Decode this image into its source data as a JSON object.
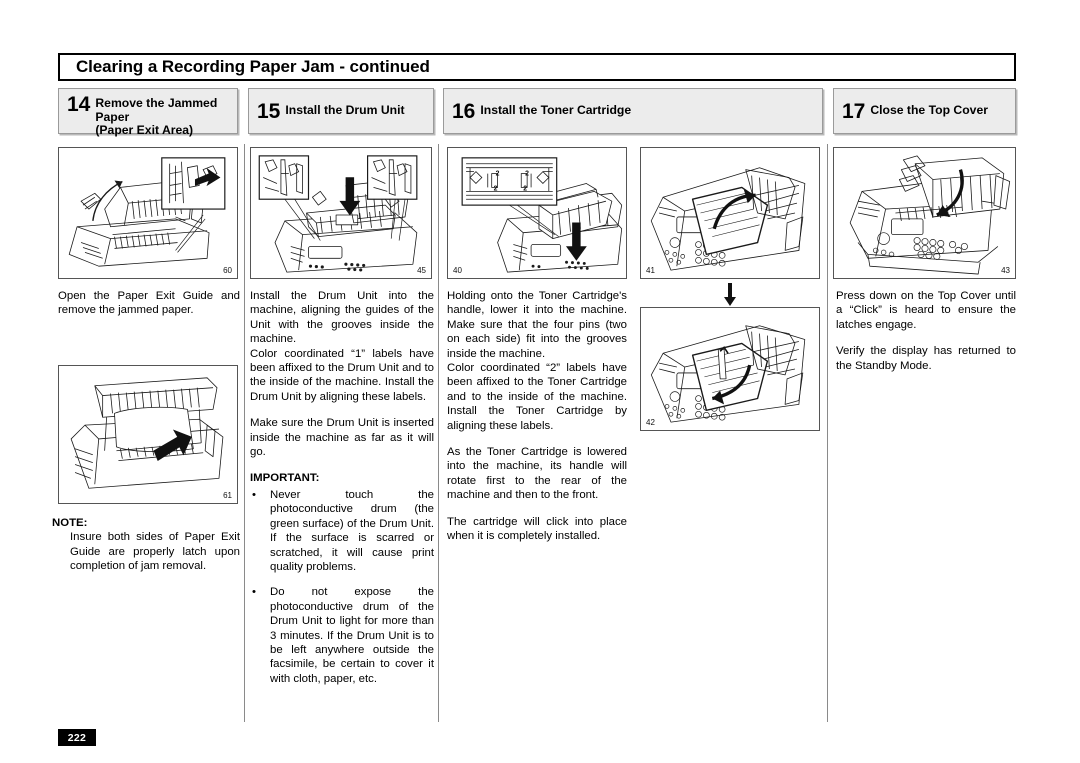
{
  "document": {
    "title": "Clearing a Recording Paper Jam - continued",
    "page_number": "222"
  },
  "steps": [
    {
      "number": "14",
      "label": "Remove the Jammed Paper\n(Paper Exit Area)",
      "figures": [
        {
          "id": "60",
          "caption_number": "60",
          "alt": "fuser-unit-paper-exit-guide-open-diagram"
        },
        {
          "id": "61",
          "caption_number": "61",
          "alt": "removing-jammed-paper-from-exit-area-diagram"
        }
      ],
      "body": [
        "Open the Paper Exit Guide and remove the jammed paper."
      ],
      "note": {
        "label": "NOTE:",
        "text": "Insure both sides of Paper Exit Guide are properly latch upon completion of jam removal."
      }
    },
    {
      "number": "15",
      "label": "Install the Drum Unit",
      "figures": [
        {
          "id": "45",
          "caption_number": "45",
          "alt": "drum-unit-insertion-with-guide-callouts-diagram"
        }
      ],
      "body": [
        "Install the Drum Unit into the machine, aligning the guides of the Unit with the grooves inside the machine.",
        "Color coordinated “1” labels have been affixed to the Drum Unit and to the inside of the machine. Install the Drum Unit by aligning these labels.",
        "Make sure the Drum Unit is inserted inside the machine as far as it will go."
      ],
      "important": {
        "label": "IMPORTANT:",
        "bullets": [
          "Never touch the photoconductive drum (the green surface) of the Drum Unit. If the surface is scarred or scratched, it will cause print quality problems.",
          "Do not expose the photoconductive drum of the Drum Unit to light for more than 3 minutes. If the Drum Unit is to be left anywhere outside the facsimile, be certain to cover it with cloth, paper, etc."
        ]
      }
    },
    {
      "number": "16",
      "label": "Install the Toner Cartridge",
      "figures": [
        {
          "id": "40",
          "caption_number": "40",
          "alt": "toner-cartridge-lowering-with-label-2-callout-diagram"
        },
        {
          "id": "41",
          "caption_number": "41",
          "alt": "toner-cartridge-handle-rotating-rear-diagram"
        },
        {
          "id": "42",
          "caption_number": "42",
          "alt": "toner-cartridge-handle-rotating-front-diagram"
        }
      ],
      "body": [
        "Holding onto the Toner Cartridge's handle, lower it into the machine. Make sure that the four pins (two on each side) fit into the grooves inside the machine.",
        "Color coordinated “2” labels have been affixed to the Toner Cartridge and to the inside of the machine. Install the Toner Cartridge by aligning these labels.",
        "As the Toner Cartridge is lowered into the machine, its handle will rotate first to the rear of the machine and then to the front.",
        "The cartridge will click into place when it is completely installed."
      ]
    },
    {
      "number": "17",
      "label": "Close the Top Cover",
      "figures": [
        {
          "id": "43",
          "caption_number": "43",
          "alt": "closing-top-cover-of-facsimile-diagram"
        }
      ],
      "body": [
        "Press down on the Top Cover until a “Click” is heard to ensure the latches engage.",
        "Verify the display has returned to the Standby Mode."
      ]
    }
  ],
  "colors": {
    "header_fill": "#ececec",
    "header_border": "#9a9a9a",
    "rule": "#8a8a8a",
    "page_badge_bg": "#000000",
    "page_badge_fg": "#ffffff"
  }
}
